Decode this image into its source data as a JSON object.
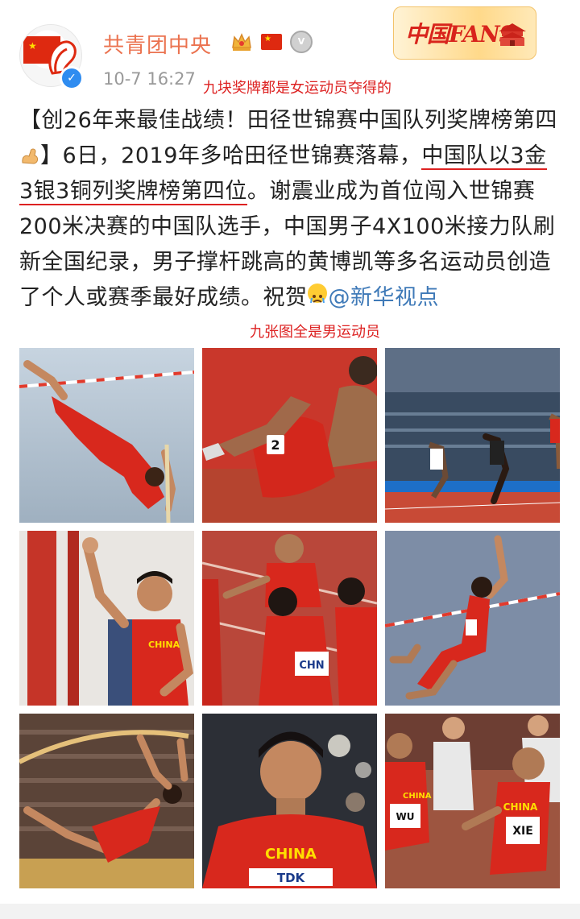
{
  "header": {
    "username": "共青团中央",
    "timestamp": "10-7 16:27",
    "annotation_top": "九块奖牌都是女运动员夺得的",
    "logo_text": "中国FANS",
    "badges": [
      "crown-badge",
      "china-flag-badge",
      "medal-badge"
    ]
  },
  "post": {
    "text_before": "【创26年来最佳战绩！田径世锦赛中国队列奖牌榜第四",
    "text_mid": "】6日，2019年多哈田径世锦赛落幕，",
    "text_underlined": "中国队以3金3银3铜列奖牌榜第四位",
    "text_after": "。谢震业成为首位闯入世锦赛200米决赛的中国队选手，中国男子4X100米接力队刷新全国纪录，男子撑杆跳高的黄博凯等多名运动员创造了个人或赛季最好成绩。祝贺",
    "mention": "@新华视点"
  },
  "annotation_mid": "九张图全是男运动员",
  "photos": [
    {
      "name": "photo-pole-vault-1",
      "bib": ""
    },
    {
      "name": "photo-athletes-sitting",
      "bib": "2"
    },
    {
      "name": "photo-stadium-race",
      "bib": ""
    },
    {
      "name": "photo-waving-athlete",
      "bib": "CHINA"
    },
    {
      "name": "photo-relay-team",
      "bib": "CHN"
    },
    {
      "name": "photo-pole-vault-2",
      "bib": ""
    },
    {
      "name": "photo-pole-vault-3",
      "bib": ""
    },
    {
      "name": "photo-sprinter-portrait",
      "bib": "CHINA",
      "sponsor": "TDK"
    },
    {
      "name": "photo-sprint-race",
      "bib1": "WU",
      "bib2": "XIE",
      "team": "CHINA"
    }
  ]
}
